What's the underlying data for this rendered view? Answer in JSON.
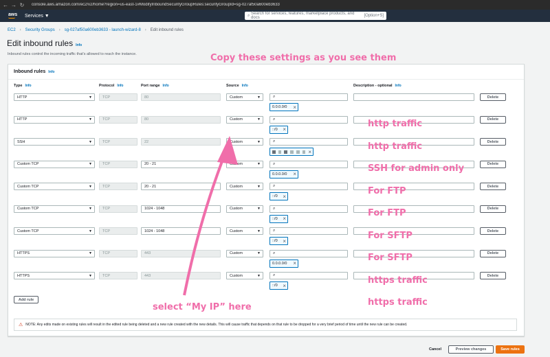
{
  "browser": {
    "url": "console.aws.amazon.com/ec2/v2/home?region=us-east-1#ModifyInboundSecurityGroupRules:securityGroupId=sg-027af50a600eb3633"
  },
  "aws_bar": {
    "logo": "aws",
    "services": "Services ▼",
    "search_placeholder": "Search for services, features, marketplace products, and docs",
    "search_shortcut": "[Option+S]"
  },
  "breadcrumb": [
    "EC2",
    "Security Groups",
    "sg-027af50a600eb3633 - launch-wizard-8",
    "Edit inbound rules"
  ],
  "page": {
    "title": "Edit inbound rules",
    "info": "Info",
    "description": "Inbound rules control the incoming traffic that's allowed to reach the instance."
  },
  "panel": {
    "title": "Inbound rules",
    "info": "Info"
  },
  "columns": {
    "type": "Type",
    "protocol": "Protocol",
    "port_range": "Port range",
    "source": "Source",
    "description": "Description - optional",
    "info": "Info"
  },
  "rules": [
    {
      "type": "HTTP",
      "protocol": "TCP",
      "port": "80",
      "port_editable": false,
      "source": "Custom",
      "cidr": "0.0.0.0/0",
      "annotation": "http traffic"
    },
    {
      "type": "HTTP",
      "protocol": "TCP",
      "port": "80",
      "port_editable": false,
      "source": "Custom",
      "cidr": "::/0",
      "annotation": "http traffic"
    },
    {
      "type": "SSH",
      "protocol": "TCP",
      "port": "22",
      "port_editable": false,
      "source": "Custom",
      "cidr": "",
      "annotation": "SSH for admin only"
    },
    {
      "type": "Custom TCP",
      "protocol": "TCP",
      "port": "20 - 21",
      "port_editable": true,
      "source": "Custom",
      "cidr": "0.0.0.0/0",
      "annotation": "For FTP"
    },
    {
      "type": "Custom TCP",
      "protocol": "TCP",
      "port": "20 - 21",
      "port_editable": true,
      "source": "Custom",
      "cidr": "::/0",
      "annotation": "For FTP"
    },
    {
      "type": "Custom TCP",
      "protocol": "TCP",
      "port": "1024 - 1048",
      "port_editable": true,
      "source": "Custom",
      "cidr": "::/0",
      "annotation": "For SFTP"
    },
    {
      "type": "Custom TCP",
      "protocol": "TCP",
      "port": "1024 - 1048",
      "port_editable": true,
      "source": "Custom",
      "cidr": "::/0",
      "annotation": "For SFTP"
    },
    {
      "type": "HTTPS",
      "protocol": "TCP",
      "port": "443",
      "port_editable": false,
      "source": "Custom",
      "cidr": "0.0.0.0/0",
      "annotation": "https traffic"
    },
    {
      "type": "HTTPS",
      "protocol": "TCP",
      "port": "443",
      "port_editable": false,
      "source": "Custom",
      "cidr": "::/0",
      "annotation": "https traffic"
    }
  ],
  "delete_label": "Delete",
  "add_rule_label": "Add rule",
  "notice": "NOTE: Any edits made on existing rules will result in the edited rule being deleted and a new rule created with the new details. This will cause traffic that depends on that rule to be dropped for a very brief period of time until the new rule can be created.",
  "footer": {
    "cancel": "Cancel",
    "preview": "Preview changes",
    "save": "Save rules"
  },
  "annotations": {
    "top": "Copy these settings as you see them",
    "arrow_label": "select “My IP” here",
    "color": "#f06eaa"
  }
}
